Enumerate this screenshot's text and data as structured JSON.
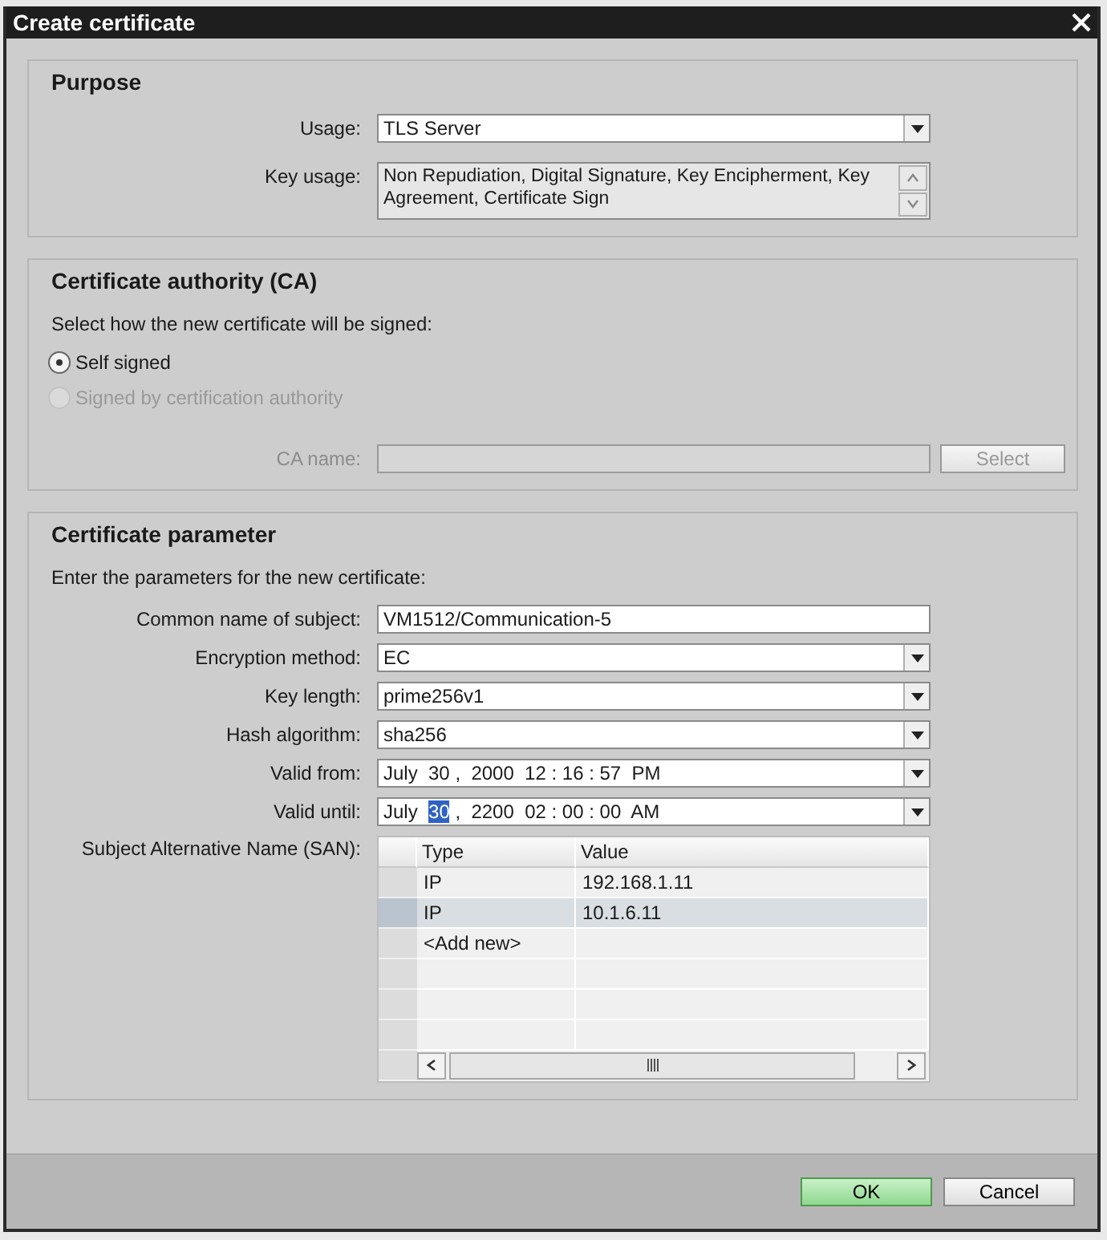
{
  "window": {
    "title": "Create certificate"
  },
  "purpose": {
    "heading": "Purpose",
    "fields": [
      {
        "label": "Usage:",
        "kind": "dropdown",
        "value": "TLS Server"
      },
      {
        "label": "Key usage:",
        "kind": "textarea",
        "value": "Non Repudiation, Digital Signature, Key Encipherment, Key Agreement, Certificate Sign"
      }
    ]
  },
  "ca": {
    "heading": "Certificate authority (CA)",
    "prompt": "Select how the new certificate will be signed:",
    "options": [
      {
        "label": "Self signed",
        "selected": true,
        "disabled": false
      },
      {
        "label": "Signed by certification authority",
        "selected": false,
        "disabled": true
      }
    ],
    "ca_name": {
      "label": "CA name:",
      "disabled": true
    },
    "select_button": {
      "label": "Select",
      "disabled": true
    }
  },
  "parameters": {
    "heading": "Certificate parameter",
    "prompt": "Enter the parameters for the new certificate:",
    "fields": [
      {
        "label": "Common name of subject:",
        "kind": "text",
        "parts": [
          {
            "text": "VM1512/Communication-5",
            "selected": false
          }
        ]
      },
      {
        "label": "Encryption method:",
        "kind": "dropdown",
        "parts": [
          {
            "text": "EC",
            "selected": false
          }
        ]
      },
      {
        "label": "Key length:",
        "kind": "dropdown",
        "parts": [
          {
            "text": "prime256v1",
            "selected": false
          }
        ]
      },
      {
        "label": "Hash algorithm:",
        "kind": "dropdown",
        "parts": [
          {
            "text": "sha256",
            "selected": false
          }
        ]
      },
      {
        "label": "Valid from:",
        "kind": "dropdown",
        "parts": [
          {
            "text": "July  30 ,  2000  12 : 16 : 57  PM",
            "selected": false
          }
        ]
      },
      {
        "label": "Valid until:",
        "kind": "dropdown",
        "parts": [
          {
            "text": "July  ",
            "selected": false
          },
          {
            "text": "30",
            "selected": true
          },
          {
            "text": " ,  2200  02 : 00 : 00  AM",
            "selected": false
          }
        ]
      }
    ],
    "san": {
      "label": "Subject Alternative Name (SAN):",
      "columns": [
        "Type",
        "Value"
      ],
      "rows": [
        {
          "cells": [
            "IP",
            "192.168.1.11"
          ],
          "selected": false
        },
        {
          "cells": [
            "IP",
            "10.1.6.11"
          ],
          "selected": true
        }
      ],
      "add_row": "<Add new>"
    }
  },
  "buttons": [
    {
      "label": "OK",
      "kind": "primary"
    },
    {
      "label": "Cancel",
      "kind": "secondary"
    }
  ]
}
